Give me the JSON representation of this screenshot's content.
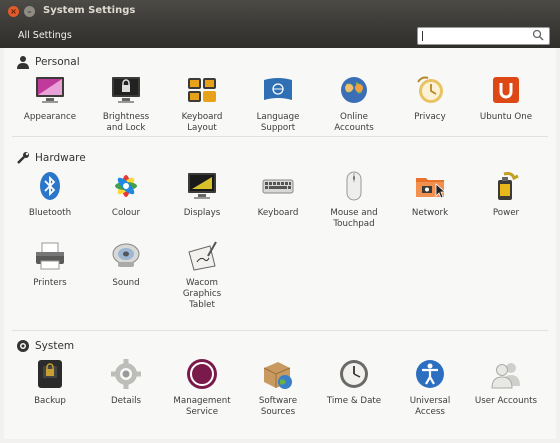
{
  "window": {
    "title": "System Settings"
  },
  "toolbar": {
    "all_settings_label": "All Settings",
    "search_value": ""
  },
  "sections": {
    "personal": {
      "label": "Personal"
    },
    "hardware": {
      "label": "Hardware"
    },
    "system": {
      "label": "System"
    }
  },
  "personal": {
    "appearance": {
      "l1": "Appearance",
      "l2": ""
    },
    "brightness_lock": {
      "l1": "Brightness",
      "l2": "and Lock"
    },
    "keyboard_layout": {
      "l1": "Keyboard",
      "l2": "Layout"
    },
    "language_support": {
      "l1": "Language",
      "l2": "Support"
    },
    "online_accounts": {
      "l1": "Online",
      "l2": "Accounts"
    },
    "privacy": {
      "l1": "Privacy",
      "l2": ""
    },
    "ubuntu_one": {
      "l1": "Ubuntu One",
      "l2": ""
    }
  },
  "hardware": {
    "bluetooth": {
      "l1": "Bluetooth",
      "l2": ""
    },
    "colour": {
      "l1": "Colour",
      "l2": ""
    },
    "displays": {
      "l1": "Displays",
      "l2": ""
    },
    "keyboard": {
      "l1": "Keyboard",
      "l2": ""
    },
    "mouse_touchpad": {
      "l1": "Mouse and",
      "l2": "Touchpad"
    },
    "network": {
      "l1": "Network",
      "l2": ""
    },
    "power": {
      "l1": "Power",
      "l2": ""
    },
    "printers": {
      "l1": "Printers",
      "l2": ""
    },
    "sound": {
      "l1": "Sound",
      "l2": ""
    },
    "wacom": {
      "l1": "Wacom",
      "l2": "Graphics",
      "l3": "Tablet"
    }
  },
  "system": {
    "backup": {
      "l1": "Backup",
      "l2": ""
    },
    "details": {
      "l1": "Details",
      "l2": ""
    },
    "management_service": {
      "l1": "Management",
      "l2": "Service"
    },
    "software_sources": {
      "l1": "Software",
      "l2": "Sources"
    },
    "time_date": {
      "l1": "Time & Date",
      "l2": ""
    },
    "universal_access": {
      "l1": "Universal",
      "l2": "Access"
    },
    "user_accounts": {
      "l1": "User Accounts",
      "l2": ""
    }
  },
  "icons": {
    "close": "close-icon",
    "minimize": "minimize-icon",
    "search": "search-icon",
    "personal": "person-icon",
    "hardware": "wrench-icon",
    "system": "gear-icon"
  },
  "colors": {
    "titlebar": "#3c3b37",
    "close_button": "#e05c2b",
    "background": "#f8f8f7"
  }
}
